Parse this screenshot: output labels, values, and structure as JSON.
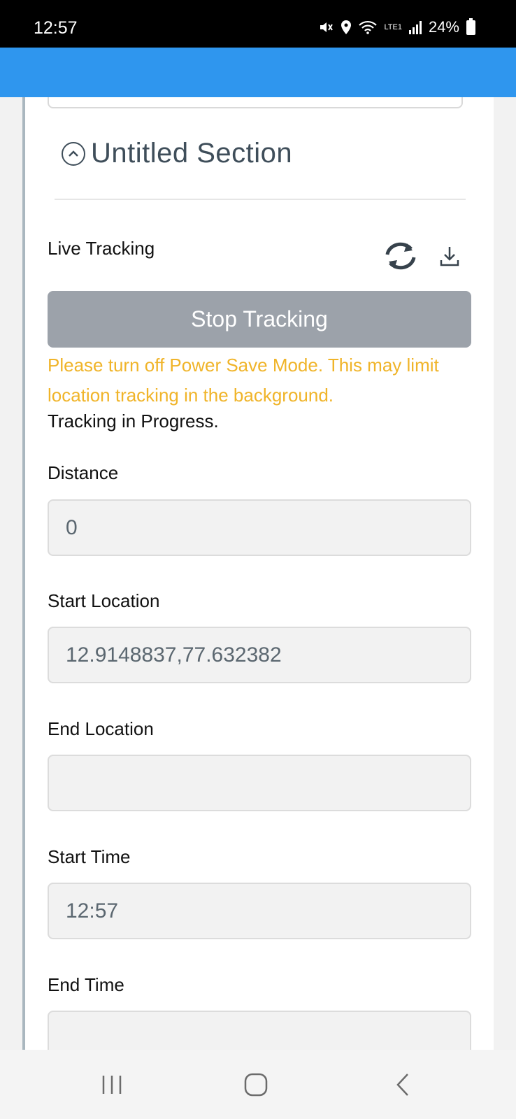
{
  "status_bar": {
    "time": "12:57",
    "battery": "24%",
    "network": "LTE1"
  },
  "section": {
    "title": "Untitled Section"
  },
  "live_tracking": {
    "label": "Live Tracking",
    "refresh_icon": "refresh-icon",
    "download_icon": "download-icon",
    "button_label": "Stop Tracking",
    "warning": "Please turn off Power Save Mode. This may limit location tracking in the background.",
    "status": "Tracking in Progress."
  },
  "fields": {
    "distance": {
      "label": "Distance",
      "value": "0"
    },
    "start_location": {
      "label": "Start Location",
      "value": "12.9148837,77.632382"
    },
    "end_location": {
      "label": "End Location",
      "value": ""
    },
    "start_time": {
      "label": "Start Time",
      "value": "12:57"
    },
    "end_time": {
      "label": "End Time",
      "value": ""
    }
  },
  "colors": {
    "app_bar": "#2f96ee",
    "warning": "#f0b429",
    "button": "#9ca2aa"
  }
}
